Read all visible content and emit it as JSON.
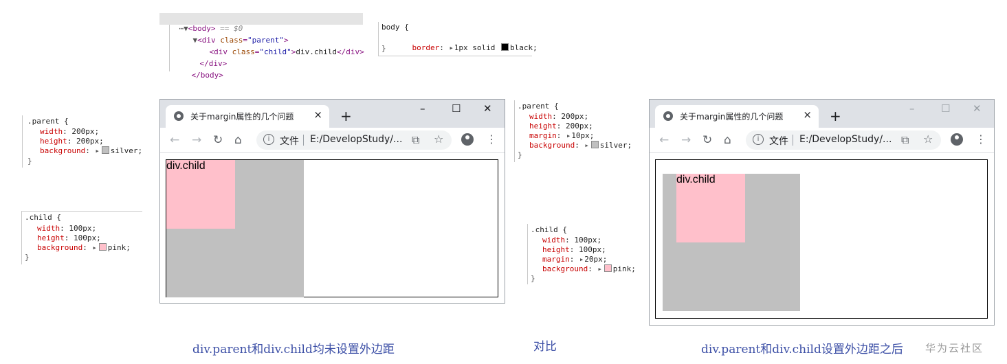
{
  "elements_panel": {
    "lines": [
      {
        "prefix": "⋯▼",
        "open": "<body>",
        "suffix": " == $0"
      },
      {
        "prefix": "▼",
        "tag_open": "<div ",
        "attr": "class",
        "eq": "=",
        "value": "\"parent\"",
        "close": ">"
      },
      {
        "tag_open": "<div ",
        "attr": "class",
        "eq": "=",
        "value": "\"child\"",
        "close": ">",
        "text": "div.child",
        "end": "</div>"
      },
      {
        "end": "</div>"
      },
      {
        "end": "</body>"
      }
    ]
  },
  "body_rule": {
    "selector": "body {",
    "prop": "border",
    "value": "1px solid ",
    "color_name": "black;",
    "swatch": "#000000",
    "close": "}"
  },
  "left_rules": {
    "parent": {
      "selector": ".parent {",
      "props": [
        {
          "name": "width",
          "value": "200px;"
        },
        {
          "name": "height",
          "value": "200px;"
        },
        {
          "name": "background",
          "value": "silver;",
          "swatch": "#c0c0c0"
        }
      ],
      "close": "}"
    },
    "child": {
      "selector": ".child {",
      "props": [
        {
          "name": "width",
          "value": "100px;"
        },
        {
          "name": "height",
          "value": "100px;"
        },
        {
          "name": "background",
          "value": "pink;",
          "swatch": "#ffc0cb"
        }
      ],
      "close": "}"
    }
  },
  "right_rules": {
    "parent": {
      "selector": ".parent {",
      "props": [
        {
          "name": "width",
          "value": "200px;"
        },
        {
          "name": "height",
          "value": "200px;"
        },
        {
          "name": "margin",
          "value": "10px;"
        },
        {
          "name": "background",
          "value": "silver;",
          "swatch": "#c0c0c0"
        }
      ],
      "close": "}"
    },
    "child": {
      "selector": ".child {",
      "props": [
        {
          "name": "width",
          "value": "100px;"
        },
        {
          "name": "height",
          "value": "100px;"
        },
        {
          "name": "margin",
          "value": "20px;"
        },
        {
          "name": "background",
          "value": "pink;",
          "swatch": "#ffc0cb"
        }
      ],
      "close": "}"
    }
  },
  "browser": {
    "tab_title": "关于margin属性的几个问题",
    "tab_close": "×",
    "new_tab": "+",
    "minimize": "–",
    "maximize": "☐",
    "close": "✕",
    "back": "←",
    "forward": "→",
    "reload": "↻",
    "home": "⌂",
    "info": "i",
    "file_label": "文件",
    "url": "E:/DevelopStudy/...",
    "translate": "⧉",
    "star": "☆",
    "menu": "⋮",
    "child_text": "div.child"
  },
  "colors": {
    "silver": "#c0c0c0",
    "pink": "#ffc0cb",
    "caption": "#3c4fa6"
  },
  "captions": {
    "left": "div.parent和div.child均未设置外边距",
    "middle": "对比",
    "right": "div.parent和div.child设置外边距之后"
  },
  "watermark": "华为云社区"
}
